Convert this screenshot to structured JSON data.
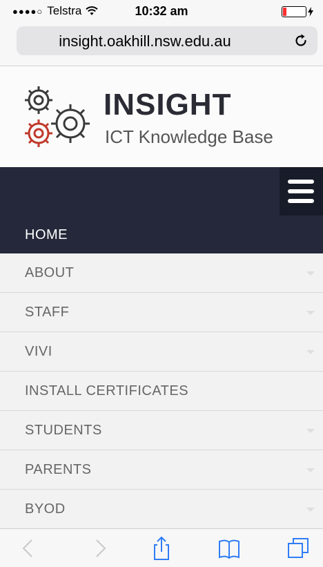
{
  "status_bar": {
    "signal": "●●●●○",
    "carrier": "Telstra",
    "time": "10:32 am",
    "battery_color": "#ff2d2d"
  },
  "browser": {
    "url": "insight.oakhill.nsw.edu.au",
    "reload_icon": "reload-icon"
  },
  "header": {
    "title": "INSIGHT",
    "subtitle": "ICT Knowledge Base",
    "logo_icon": "gears-icon",
    "logo_colors": [
      "#3a3a3a",
      "#c0392b"
    ]
  },
  "nav": {
    "menu_icon": "hamburger-icon",
    "bar_color": "#24283a"
  },
  "menu": {
    "items": [
      {
        "label": "HOME"
      },
      {
        "label": "ABOUT"
      },
      {
        "label": "STAFF"
      },
      {
        "label": "VIVI"
      },
      {
        "label": "INSTALL CERTIFICATES"
      },
      {
        "label": "STUDENTS"
      },
      {
        "label": "PARENTS"
      },
      {
        "label": "BYOD"
      }
    ]
  },
  "toolbar": {
    "icons": [
      "back-icon",
      "forward-icon",
      "share-icon",
      "bookmarks-icon",
      "tabs-icon"
    ],
    "accent": "#2f7cf6"
  }
}
